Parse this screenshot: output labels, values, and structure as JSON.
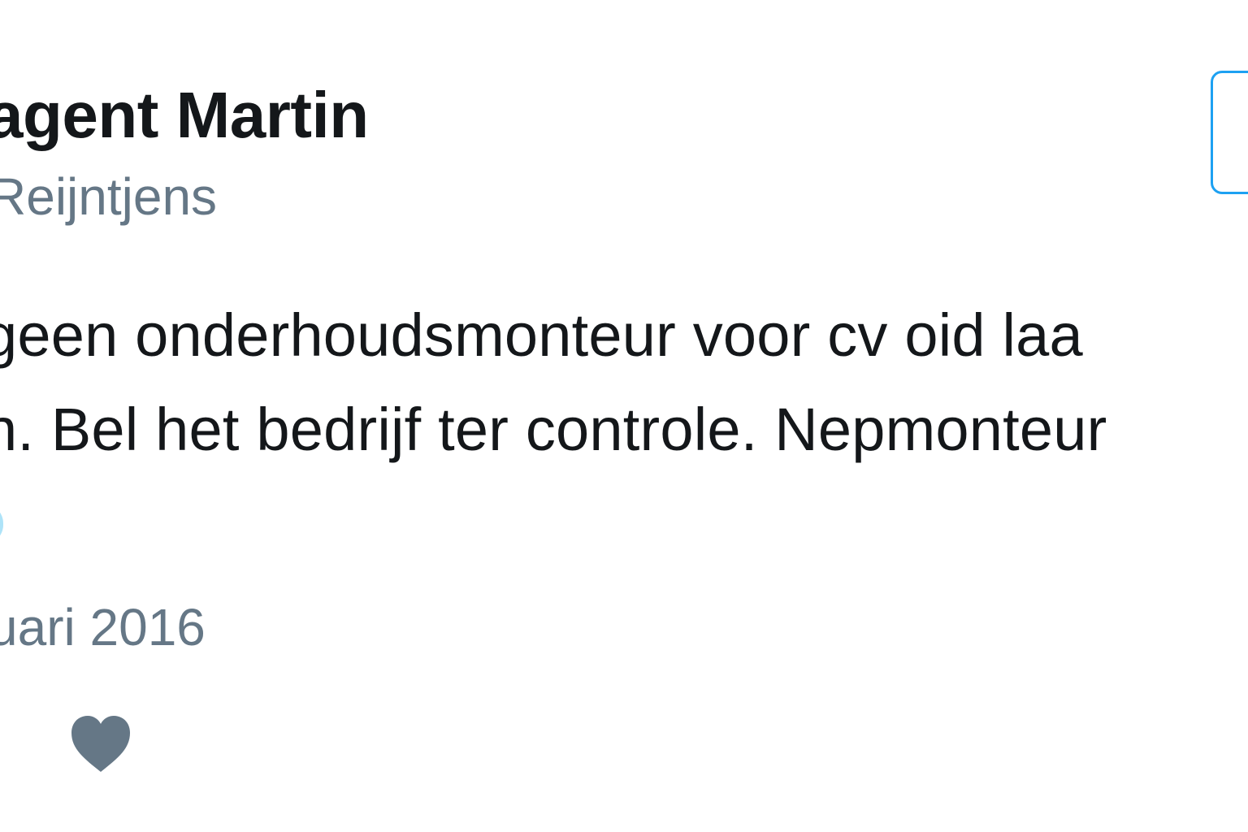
{
  "author": {
    "display_name": "agent Martin",
    "handle": "Reijntjens"
  },
  "tweet": {
    "lines": [
      "geen onderhoudsmonteur voor cv oid laa",
      "n. Bel het bedrijf ter controle. Nepmonteur"
    ],
    "timestamp": "uari 2016"
  },
  "actions": {
    "like_icon": "heart-icon"
  },
  "colors": {
    "text": "#14171a",
    "secondary": "#657786",
    "accent": "#1da1f2",
    "icon": "#657786"
  }
}
